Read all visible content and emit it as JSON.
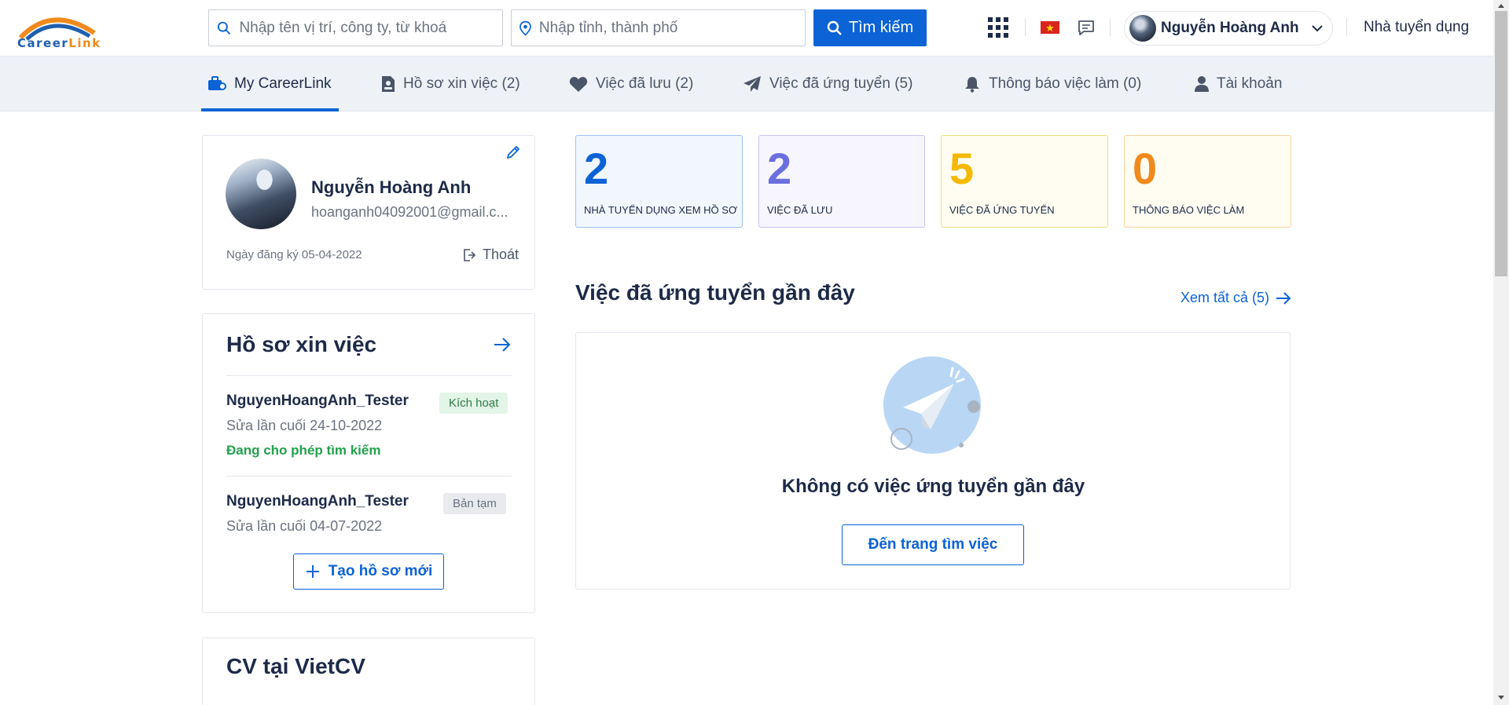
{
  "header": {
    "logo_text_1": "Career",
    "logo_text_2": "Link",
    "search_placeholder": "Nhập tên vị trí, công ty, từ khoá",
    "location_placeholder": "Nhập tỉnh, thành phố",
    "search_button": "Tìm kiếm",
    "user_name": "Nguyễn Hoàng Anh",
    "employer_link": "Nhà tuyển dụng"
  },
  "nav": {
    "items": [
      {
        "label": "My CareerLink"
      },
      {
        "label": "Hồ sơ xin việc (2)"
      },
      {
        "label": "Việc đã lưu (2)"
      },
      {
        "label": "Việc đã ứng tuyển (5)"
      },
      {
        "label": "Thông báo việc làm (0)"
      },
      {
        "label": "Tài khoản"
      }
    ]
  },
  "profile": {
    "name": "Nguyễn Hoàng Anh",
    "email": "hoanganh04092001@gmail.c...",
    "registered": "Ngày đăng ký 05-04-2022",
    "logout": "Thoát"
  },
  "resumes": {
    "title": "Hồ sơ xin việc",
    "items": [
      {
        "name": "NguyenHoangAnh_Tester",
        "edited": "Sửa lần cuối 24-10-2022",
        "badge": "Kích hoạt",
        "status": "Đang cho phép tìm kiếm"
      },
      {
        "name": "NguyenHoangAnh_Tester",
        "edited": "Sửa lần cuối 04-07-2022",
        "badge": "Bản tạm"
      }
    ],
    "create_button": "Tạo hồ sơ mới"
  },
  "vietcv": {
    "title": "CV tại VietCV"
  },
  "stats": [
    {
      "value": "2",
      "label": "NHÀ TUYỂN DỤNG XEM HỒ SƠ",
      "color": "#0b63d6"
    },
    {
      "value": "2",
      "label": "VIỆC ĐÃ LƯU",
      "color": "#6b6fe0"
    },
    {
      "value": "5",
      "label": "VIỆC ĐÃ ỨNG TUYỂN",
      "color": "#f5b800"
    },
    {
      "value": "0",
      "label": "THÔNG BÁO VIỆC LÀM",
      "color": "#f08a1c"
    }
  ],
  "recent": {
    "title": "Việc đã ứng tuyển gần đây",
    "see_all": "Xem tất cả (5)",
    "empty_message": "Không có việc ứng tuyển gần đây",
    "cta": "Đến trang tìm việc"
  },
  "colors": {
    "primary": "#0b63d6",
    "success": "#21a14b",
    "text_dark": "#1d2a48"
  }
}
